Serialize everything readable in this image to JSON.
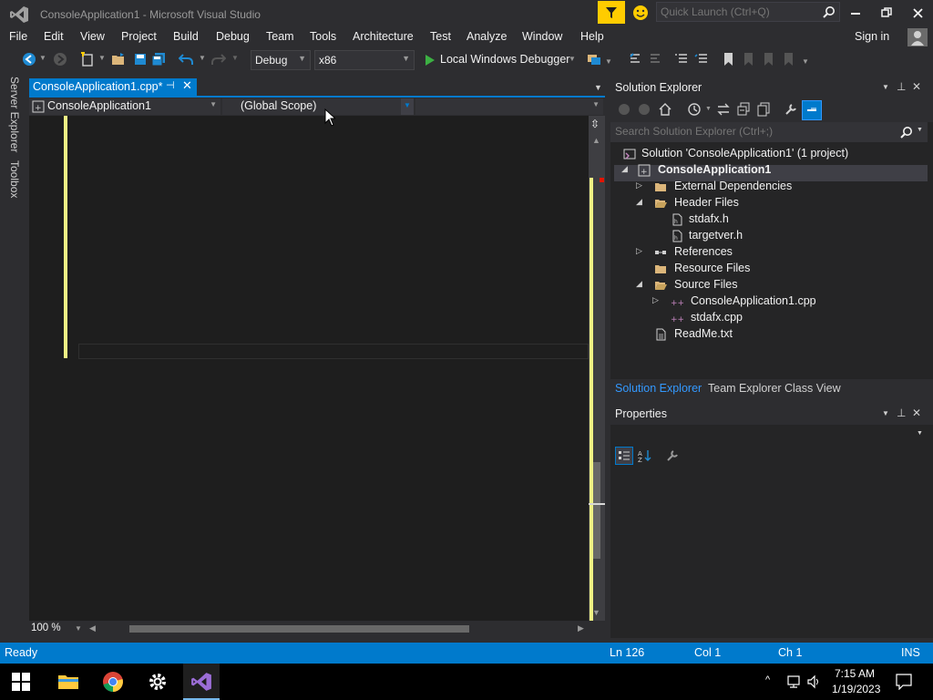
{
  "window": {
    "title": "ConsoleApplication1 - Microsoft Visual Studio",
    "quick_launch_placeholder": "Quick Launch (Ctrl+Q)"
  },
  "menu": {
    "items": [
      "File",
      "Edit",
      "View",
      "Project",
      "Build",
      "Debug",
      "Team",
      "Tools",
      "Architecture",
      "Test",
      "Analyze",
      "Window",
      "Help"
    ],
    "sign_in": "Sign in"
  },
  "toolbar": {
    "configuration": "Debug",
    "platform": "x86",
    "run_target": "Local Windows Debugger"
  },
  "left_tabs": [
    "Server Explorer",
    "Toolbox"
  ],
  "editor": {
    "tab_label": "ConsoleApplication1.cpp*",
    "nav_project": "ConsoleApplication1",
    "nav_scope": "(Global Scope)",
    "zoom": "100 %"
  },
  "solution_explorer": {
    "title": "Solution Explorer",
    "search_placeholder": "Search Solution Explorer (Ctrl+;)",
    "tree": [
      {
        "label": "Solution 'ConsoleApplication1' (1 project)",
        "icon": "solution-icon",
        "expander": ""
      },
      {
        "label": "ConsoleApplication1",
        "icon": "project-icon",
        "expander": "◢",
        "bold": true
      },
      {
        "label": "External Dependencies",
        "icon": "folder-icon",
        "expander": "▷"
      },
      {
        "label": "Header Files",
        "icon": "folder-icon",
        "expander": "◢"
      },
      {
        "label": "stdafx.h",
        "icon": "header-file-icon",
        "expander": ""
      },
      {
        "label": "targetver.h",
        "icon": "header-file-icon",
        "expander": ""
      },
      {
        "label": "References",
        "icon": "references-icon",
        "expander": "▷"
      },
      {
        "label": "Resource Files",
        "icon": "folder-icon",
        "expander": ""
      },
      {
        "label": "Source Files",
        "icon": "folder-icon",
        "expander": "◢"
      },
      {
        "label": "ConsoleApplication1.cpp",
        "icon": "cpp-file-icon",
        "expander": "▷"
      },
      {
        "label": "stdafx.cpp",
        "icon": "cpp-file-icon",
        "expander": ""
      },
      {
        "label": "ReadMe.txt",
        "icon": "text-file-icon",
        "expander": ""
      }
    ],
    "bottom_tabs": [
      "Solution Explorer",
      "Team Explorer",
      "Class View"
    ]
  },
  "properties": {
    "title": "Properties"
  },
  "statusbar": {
    "state": "Ready",
    "line": "Ln 126",
    "col": "Col 1",
    "ch": "Ch 1",
    "mode": "INS"
  },
  "taskbar": {
    "time": "7:15 AM",
    "date": "1/19/2023"
  },
  "colors": {
    "accent": "#007acc",
    "change_marker": "#eff284",
    "filter": "#ffcc00"
  }
}
